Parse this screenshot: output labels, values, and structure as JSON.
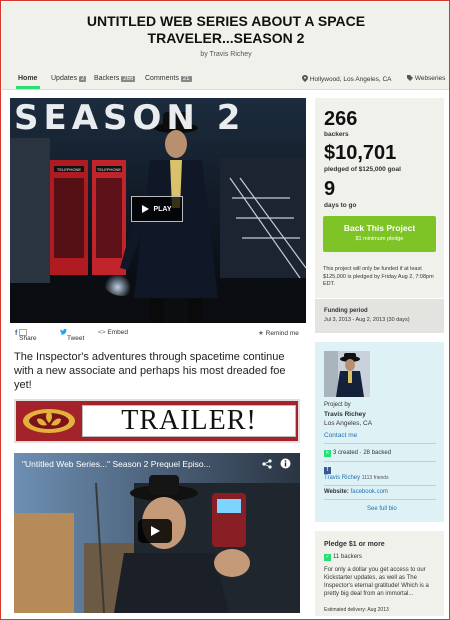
{
  "header": {
    "title": "UNTITLED WEB SERIES ABOUT A SPACE TRAVELER...SEASON 2",
    "byline": "by Travis Richey"
  },
  "tabs": [
    {
      "label": "Home",
      "count": ""
    },
    {
      "label": "Updates",
      "count": "2"
    },
    {
      "label": "Backers",
      "count": "266"
    },
    {
      "label": "Comments",
      "count": "21"
    }
  ],
  "location": "Hollywood, Los Angeles, CA",
  "category": "Webseries",
  "video": {
    "overlay_text": "SEASON 2",
    "play_label": "PLAY",
    "booth_sign": "TELEPHONE"
  },
  "share": {
    "share_label": "Share",
    "tweet_label": "Tweet",
    "embed_label": "Embed",
    "remind_label": "Remind me"
  },
  "blurb": "The Inspector's adventures through spacetime continue with a new associate and perhaps his most dreaded foe yet!",
  "trailer_banner": "TRAILER!",
  "youtube": {
    "title": "\"Untitled Web Series...\" Season 2 Prequel Episo..."
  },
  "stats": {
    "backers_count": "266",
    "backers_label": "backers",
    "pledged_amount": "$10,701",
    "pledged_label": "pledged of $125,000 goal",
    "days_count": "9",
    "days_label": "days to go",
    "back_button": "Back This Project",
    "min_pledge": "$1 minimum pledge",
    "fineprint": "This project will only be funded if at least $125,000 is pledged by Friday Aug 2, 7:08pm EDT."
  },
  "funding": {
    "label": "Funding period",
    "dates": "Jul 3, 2013 - Aug 2, 2013 (30 days)"
  },
  "creator": {
    "project_by": "Project by",
    "name": "Travis Richey",
    "location": "Los Angeles, CA",
    "contact": "Contact me",
    "created_backed": "3 created · 28 backed",
    "fb_name": "Travis Richey",
    "fb_friends": "1113 friends",
    "website_label": "Website:",
    "website": "facebook.com",
    "full_bio": "See full bio"
  },
  "pledge": {
    "title": "Pledge $1 or more",
    "backers": "11 backers",
    "description": "For only a dollar you get access to our Kickstarter updates, as well as The Inspector's eternal gratitude! Which is a pretty big deal from an immortal...",
    "delivery": "Estimated delivery: Aug 2013"
  },
  "colors": {
    "accent_green": "#2bde73",
    "back_button_green": "#7fc426",
    "trailer_red": "#a42229",
    "creator_bg": "#def2f5",
    "link_blue": "#1e6fb5"
  }
}
